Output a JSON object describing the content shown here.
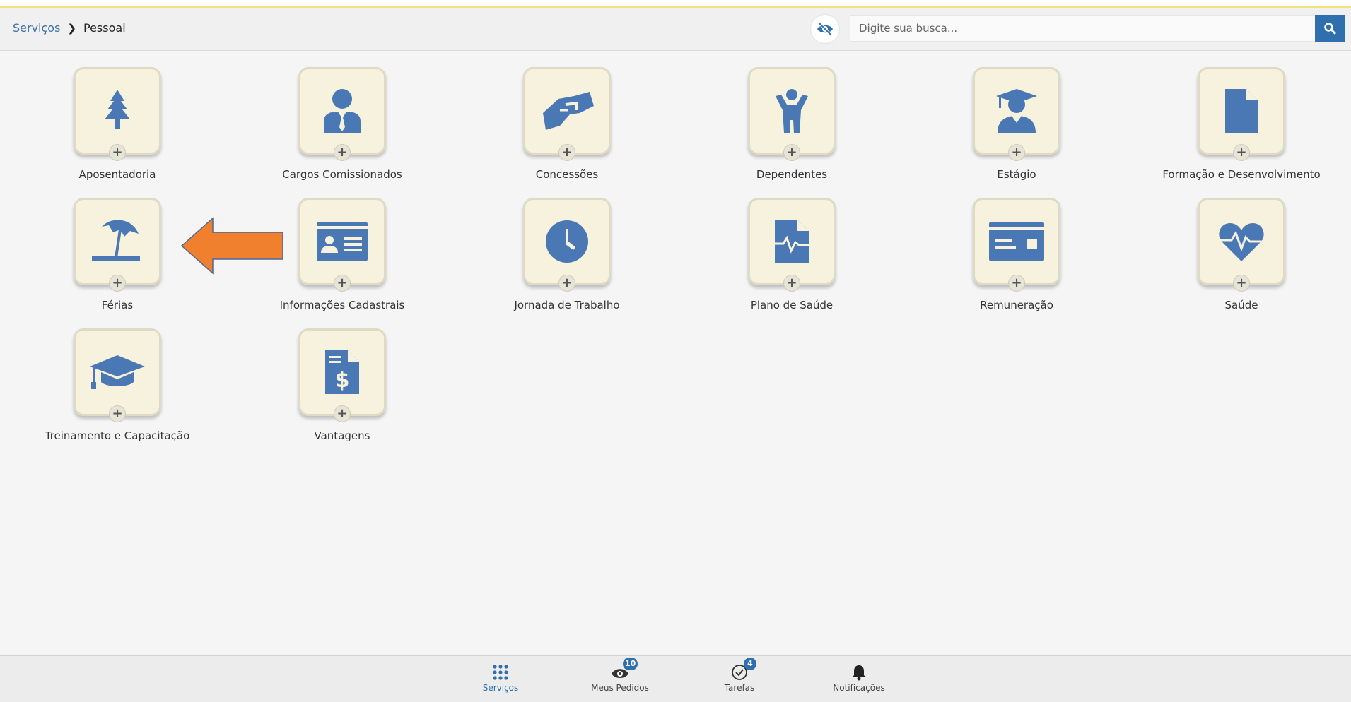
{
  "breadcrumb": {
    "root": "Serviços",
    "current": "Pessoal"
  },
  "search": {
    "placeholder": "Digite sua busca..."
  },
  "colors": {
    "icon": "#4a78b5",
    "arrow": "#f07f2e",
    "accent": "#2f6fae"
  },
  "tiles": [
    {
      "label": "Aposentadoria",
      "icon": "tree-icon"
    },
    {
      "label": "Cargos Comissionados",
      "icon": "person-suit-icon"
    },
    {
      "label": "Concessões",
      "icon": "handshake-icon"
    },
    {
      "label": "Dependentes",
      "icon": "child-icon"
    },
    {
      "label": "Estágio",
      "icon": "graduate-icon"
    },
    {
      "label": "Formação e Desenvolvimento",
      "icon": "document-icon"
    },
    {
      "label": "Férias",
      "icon": "umbrella-icon"
    },
    {
      "label": "Informações Cadastrais",
      "icon": "id-card-icon"
    },
    {
      "label": "Jornada de Trabalho",
      "icon": "clock-icon"
    },
    {
      "label": "Plano de Saúde",
      "icon": "medical-file-icon"
    },
    {
      "label": "Remuneração",
      "icon": "payment-card-icon"
    },
    {
      "label": "Saúde",
      "icon": "heartbeat-icon"
    },
    {
      "label": "Treinamento e Capacitação",
      "icon": "mortarboard-icon"
    },
    {
      "label": "Vantagens",
      "icon": "invoice-dollar-icon"
    }
  ],
  "tile_plus": "+",
  "bottom_nav": [
    {
      "label": "Serviços",
      "icon": "grid-icon",
      "active": true
    },
    {
      "label": "Meus Pedidos",
      "icon": "eye-icon",
      "badge": "10"
    },
    {
      "label": "Tarefas",
      "icon": "check-circle-icon",
      "badge": "4"
    },
    {
      "label": "Notificações",
      "icon": "bell-icon"
    }
  ]
}
